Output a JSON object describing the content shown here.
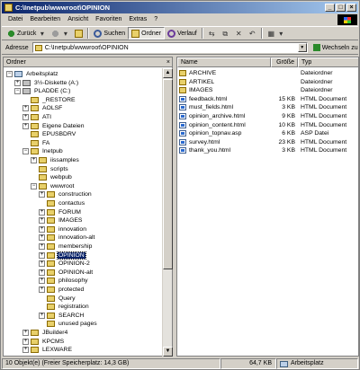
{
  "window": {
    "title": "C:\\Inetpub\\wwwroot\\OPINION"
  },
  "menu": [
    "Datei",
    "Bearbeiten",
    "Ansicht",
    "Favoriten",
    "Extras",
    "?"
  ],
  "toolbar": {
    "back": "Zurück",
    "search": "Suchen",
    "folders": "Ordner",
    "history": "Verlauf"
  },
  "address": {
    "label": "Adresse",
    "value": "C:\\Inetpub\\wwwroot\\OPINION",
    "go": "Wechseln zu"
  },
  "folderpane": {
    "title": "Ordner",
    "close": "×",
    "tree": [
      {
        "label": "Arbeitsplatz",
        "level": 0,
        "icon": "pc",
        "expander": "-"
      },
      {
        "label": "3½-Diskette (A:)",
        "level": 1,
        "icon": "drv",
        "expander": "+"
      },
      {
        "label": "PLADDE (C:)",
        "level": 1,
        "icon": "drv",
        "expander": "-"
      },
      {
        "label": "_RESTORE",
        "level": 2,
        "icon": "folder",
        "expander": ""
      },
      {
        "label": "AOLSF",
        "level": 2,
        "icon": "folder",
        "expander": "+"
      },
      {
        "label": "ATI",
        "level": 2,
        "icon": "folder",
        "expander": "+"
      },
      {
        "label": "Eigene Dateien",
        "level": 2,
        "icon": "folder",
        "expander": "+"
      },
      {
        "label": "EPUSBDRV",
        "level": 2,
        "icon": "folder",
        "expander": ""
      },
      {
        "label": "FA",
        "level": 2,
        "icon": "folder",
        "expander": ""
      },
      {
        "label": "Inetpub",
        "level": 2,
        "icon": "folder",
        "expander": "-"
      },
      {
        "label": "iissamples",
        "level": 3,
        "icon": "folder",
        "expander": "+"
      },
      {
        "label": "scripts",
        "level": 3,
        "icon": "folder",
        "expander": ""
      },
      {
        "label": "webpub",
        "level": 3,
        "icon": "folder",
        "expander": ""
      },
      {
        "label": "wwwroot",
        "level": 3,
        "icon": "folder",
        "expander": "-"
      },
      {
        "label": "construction",
        "level": 4,
        "icon": "folder",
        "expander": "+"
      },
      {
        "label": "contactus",
        "level": 4,
        "icon": "folder",
        "expander": ""
      },
      {
        "label": "FORUM",
        "level": 4,
        "icon": "folder",
        "expander": "+"
      },
      {
        "label": "IMAGES",
        "level": 4,
        "icon": "folder",
        "expander": "+"
      },
      {
        "label": "innovation",
        "level": 4,
        "icon": "folder",
        "expander": "+"
      },
      {
        "label": "innovation-alt",
        "level": 4,
        "icon": "folder",
        "expander": "+"
      },
      {
        "label": "membership",
        "level": 4,
        "icon": "folder",
        "expander": "+"
      },
      {
        "label": "OPINION",
        "level": 4,
        "icon": "folder",
        "expander": "+",
        "selected": true
      },
      {
        "label": "OPINION-2",
        "level": 4,
        "icon": "folder",
        "expander": "+"
      },
      {
        "label": "OPINION-alt",
        "level": 4,
        "icon": "folder",
        "expander": "+"
      },
      {
        "label": "philosophy",
        "level": 4,
        "icon": "folder",
        "expander": "+"
      },
      {
        "label": "protected",
        "level": 4,
        "icon": "folder",
        "expander": "+"
      },
      {
        "label": "Query",
        "level": 4,
        "icon": "folder",
        "expander": ""
      },
      {
        "label": "registration",
        "level": 4,
        "icon": "folder",
        "expander": ""
      },
      {
        "label": "SEARCH",
        "level": 4,
        "icon": "folder",
        "expander": "+"
      },
      {
        "label": "unused pages",
        "level": 4,
        "icon": "folder",
        "expander": ""
      },
      {
        "label": "JBuilder4",
        "level": 2,
        "icon": "folder",
        "expander": "+"
      },
      {
        "label": "KPCMS",
        "level": 2,
        "icon": "folder",
        "expander": "+"
      },
      {
        "label": "LEXWARE",
        "level": 2,
        "icon": "folder",
        "expander": "+"
      }
    ]
  },
  "filelist": {
    "columns": {
      "name": "Name",
      "size": "Größe",
      "type": "Typ"
    },
    "rows": [
      {
        "name": "ARCHIVE",
        "size": "",
        "type": "Dateiordner",
        "icon": "folder"
      },
      {
        "name": "ARTIKEL",
        "size": "",
        "type": "Dateiordner",
        "icon": "folder"
      },
      {
        "name": "IMAGES",
        "size": "",
        "type": "Dateiordner",
        "icon": "folder"
      },
      {
        "name": "feedback.html",
        "size": "15 KB",
        "type": "HTML Document",
        "icon": "doc"
      },
      {
        "name": "must_fields.html",
        "size": "3 KB",
        "type": "HTML Document",
        "icon": "doc"
      },
      {
        "name": "opinion_archive.html",
        "size": "9 KB",
        "type": "HTML Document",
        "icon": "doc"
      },
      {
        "name": "opinion_content.html",
        "size": "10 KB",
        "type": "HTML Document",
        "icon": "doc"
      },
      {
        "name": "opinion_topnav.asp",
        "size": "6 KB",
        "type": "ASP Datei",
        "icon": "doc"
      },
      {
        "name": "survey.html",
        "size": "23 KB",
        "type": "HTML Document",
        "icon": "doc"
      },
      {
        "name": "thank_you.html",
        "size": "3 KB",
        "type": "HTML Document",
        "icon": "doc"
      }
    ]
  },
  "status": {
    "objects": "10 Objekt(e) (Freier Speicherplatz: 14,3 GB)",
    "size": "64,7 KB",
    "location": "Arbeitsplatz"
  }
}
